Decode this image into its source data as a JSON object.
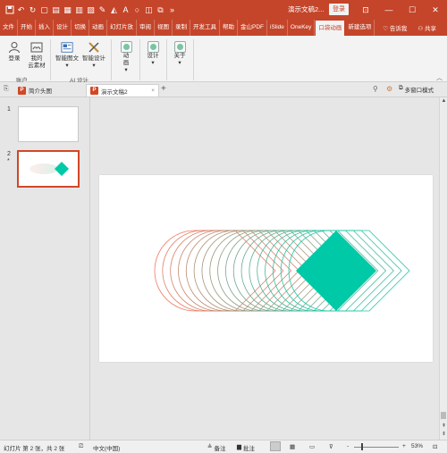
{
  "titlebar": {
    "quick_access": [
      "save-icon",
      "undo-icon",
      "redo-icon",
      "new-icon",
      "open-icon",
      "print-icon",
      "table-icon",
      "layout-icon",
      "pen-icon",
      "fill-icon",
      "font-color-icon",
      "shape-icon",
      "picture-icon",
      "arrange-icon",
      "more-icon"
    ],
    "doc_title": "演示文稿2...",
    "login_label": "登录",
    "window_controls": [
      "ribbon-display-icon",
      "minimize-icon",
      "maximize-icon",
      "close-icon"
    ]
  },
  "ribbon_tabs": {
    "items": [
      "文件",
      "开始",
      "插入",
      "设计",
      "切换",
      "动画",
      "幻灯片放",
      "审阅",
      "视图",
      "录制",
      "开发工具",
      "帮助",
      "金山PDF",
      "iSlide",
      "OneKey",
      "口袋动画",
      "新建选项"
    ],
    "active_index": 15,
    "tell_me": "告诉我",
    "share": "共享"
  },
  "ribbon": {
    "login": "登录",
    "my_material_line1": "我的",
    "my_material_line2": "云素材",
    "account_group": "账户",
    "smart_text_line1": "智能图文",
    "smart_design_line1": "智能设计",
    "ai_group": "AI 设计",
    "animation_line1": "动",
    "animation_line2": "画",
    "design_label": "设计",
    "about_label": "关于"
  },
  "doc_tabs": {
    "tab1": "简介头图",
    "tab2": "演示文稿2",
    "add": "+",
    "multi_window": "多窗口模式"
  },
  "thumbnails": {
    "slide1_number": "1",
    "slide2_number": "2",
    "slide2_star": "*"
  },
  "status": {
    "slide_info": "幻灯片 第 2 张，共 2 张",
    "language": "中文(中国)",
    "notes": "备注",
    "comments": "批注",
    "zoom_minus": "-",
    "zoom_plus": "+",
    "zoom": "53%"
  },
  "colors": {
    "accent": "#c5452a",
    "diamond": "#00c9a7",
    "gradient_start": "#f07a63",
    "gradient_end": "#1cc9a8"
  },
  "slide_graphic": {
    "copies": 18
  }
}
